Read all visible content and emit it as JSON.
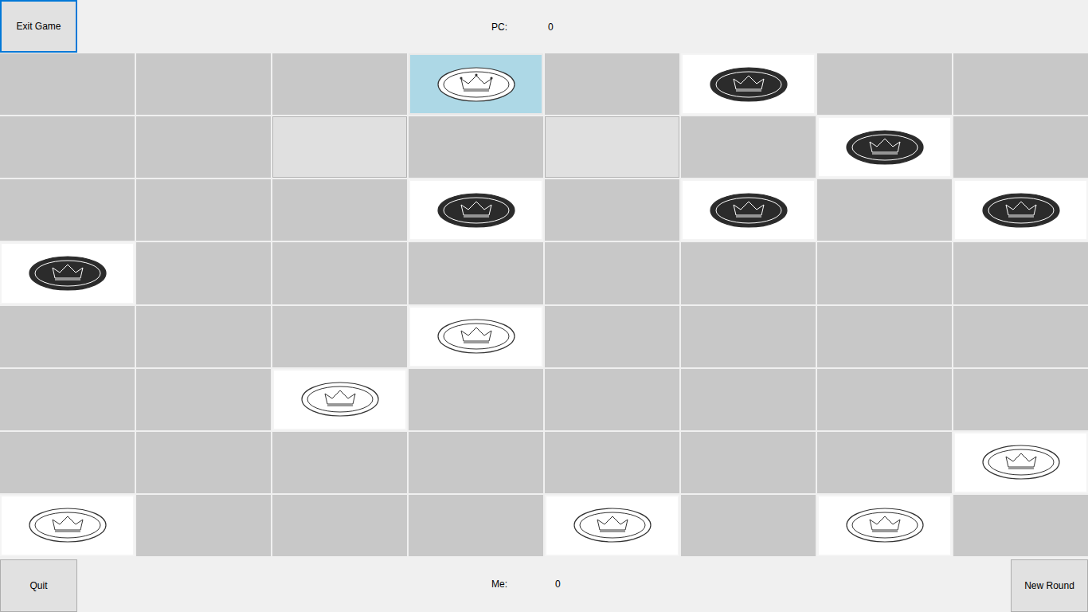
{
  "header": {
    "exit_button": {
      "label": "Exit Game",
      "focused": true
    },
    "pc_label": "PC:",
    "pc_score": "0"
  },
  "board": {
    "rows": [
      {
        "cells": [
          {
            "piece": "empty",
            "selected": false,
            "hint": false
          },
          {
            "piece": "empty",
            "selected": false,
            "hint": false
          },
          {
            "piece": "empty",
            "selected": false,
            "hint": false
          },
          {
            "piece": "white",
            "selected": true,
            "hint": false
          },
          {
            "piece": "empty",
            "selected": false,
            "hint": false
          },
          {
            "piece": "black",
            "selected": false,
            "hint": false
          },
          {
            "piece": "empty",
            "selected": false,
            "hint": false
          },
          {
            "piece": "empty",
            "selected": false,
            "hint": false
          }
        ]
      },
      {
        "cells": [
          {
            "piece": "empty",
            "selected": false,
            "hint": false
          },
          {
            "piece": "empty",
            "selected": false,
            "hint": false
          },
          {
            "piece": "empty",
            "selected": false,
            "hint": true
          },
          {
            "piece": "empty",
            "selected": false,
            "hint": false
          },
          {
            "piece": "empty",
            "selected": false,
            "hint": true
          },
          {
            "piece": "empty",
            "selected": false,
            "hint": false
          },
          {
            "piece": "black",
            "selected": false,
            "hint": false
          },
          {
            "piece": "empty",
            "selected": false,
            "hint": false
          }
        ]
      },
      {
        "cells": [
          {
            "piece": "empty",
            "selected": false,
            "hint": false
          },
          {
            "piece": "empty",
            "selected": false,
            "hint": false
          },
          {
            "piece": "empty",
            "selected": false,
            "hint": false
          },
          {
            "piece": "black",
            "selected": false,
            "hint": false
          },
          {
            "piece": "empty",
            "selected": false,
            "hint": false
          },
          {
            "piece": "black",
            "selected": false,
            "hint": false
          },
          {
            "piece": "empty",
            "selected": false,
            "hint": false
          },
          {
            "piece": "black",
            "selected": false,
            "hint": false
          }
        ]
      },
      {
        "cells": [
          {
            "piece": "black",
            "selected": false,
            "hint": false
          },
          {
            "piece": "empty",
            "selected": false,
            "hint": false
          },
          {
            "piece": "empty",
            "selected": false,
            "hint": false
          },
          {
            "piece": "empty",
            "selected": false,
            "hint": false
          },
          {
            "piece": "empty",
            "selected": false,
            "hint": false
          },
          {
            "piece": "empty",
            "selected": false,
            "hint": false
          },
          {
            "piece": "empty",
            "selected": false,
            "hint": false
          },
          {
            "piece": "empty",
            "selected": false,
            "hint": false
          }
        ]
      },
      {
        "cells": [
          {
            "piece": "empty",
            "selected": false,
            "hint": false
          },
          {
            "piece": "empty",
            "selected": false,
            "hint": false
          },
          {
            "piece": "empty",
            "selected": false,
            "hint": false
          },
          {
            "piece": "white",
            "selected": false,
            "hint": false
          },
          {
            "piece": "empty",
            "selected": false,
            "hint": false
          },
          {
            "piece": "empty",
            "selected": false,
            "hint": false
          },
          {
            "piece": "empty",
            "selected": false,
            "hint": false
          },
          {
            "piece": "empty",
            "selected": false,
            "hint": false
          }
        ]
      },
      {
        "cells": [
          {
            "piece": "empty",
            "selected": false,
            "hint": false
          },
          {
            "piece": "empty",
            "selected": false,
            "hint": false
          },
          {
            "piece": "white",
            "selected": false,
            "hint": false
          },
          {
            "piece": "empty",
            "selected": false,
            "hint": false
          },
          {
            "piece": "empty",
            "selected": false,
            "hint": false
          },
          {
            "piece": "empty",
            "selected": false,
            "hint": false
          },
          {
            "piece": "empty",
            "selected": false,
            "hint": false
          },
          {
            "piece": "empty",
            "selected": false,
            "hint": false
          }
        ]
      },
      {
        "cells": [
          {
            "piece": "empty",
            "selected": false,
            "hint": false
          },
          {
            "piece": "empty",
            "selected": false,
            "hint": false
          },
          {
            "piece": "empty",
            "selected": false,
            "hint": false
          },
          {
            "piece": "empty",
            "selected": false,
            "hint": false
          },
          {
            "piece": "empty",
            "selected": false,
            "hint": false
          },
          {
            "piece": "empty",
            "selected": false,
            "hint": false
          },
          {
            "piece": "empty",
            "selected": false,
            "hint": false
          },
          {
            "piece": "white",
            "selected": false,
            "hint": false
          }
        ]
      },
      {
        "cells": [
          {
            "piece": "white",
            "selected": false,
            "hint": false
          },
          {
            "piece": "empty",
            "selected": false,
            "hint": false
          },
          {
            "piece": "empty",
            "selected": false,
            "hint": false
          },
          {
            "piece": "empty",
            "selected": false,
            "hint": false
          },
          {
            "piece": "white",
            "selected": false,
            "hint": false
          },
          {
            "piece": "empty",
            "selected": false,
            "hint": false
          },
          {
            "piece": "white",
            "selected": false,
            "hint": false
          },
          {
            "piece": "empty",
            "selected": false,
            "hint": false
          }
        ]
      }
    ]
  },
  "footer": {
    "quit_button": "Quit",
    "me_label": "Me:",
    "me_score": "0",
    "new_round_button": "New Round"
  }
}
